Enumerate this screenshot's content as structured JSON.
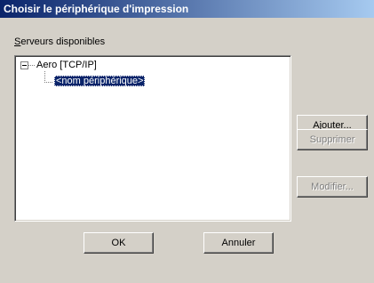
{
  "window": {
    "title": "Choisir le périphérique d'impression"
  },
  "servers": {
    "label_accel": "S",
    "label_rest": "erveurs disponibles",
    "tree": {
      "server": "Aero  [TCP/IP]",
      "device": "<nom périphérique>"
    }
  },
  "buttons": {
    "add": "Ajouter...",
    "delete": "Supprimer",
    "modify": "Modifier...",
    "ok": "OK",
    "cancel": "Annuler"
  },
  "icons": {
    "expander": "tree-collapse-minus-icon"
  }
}
